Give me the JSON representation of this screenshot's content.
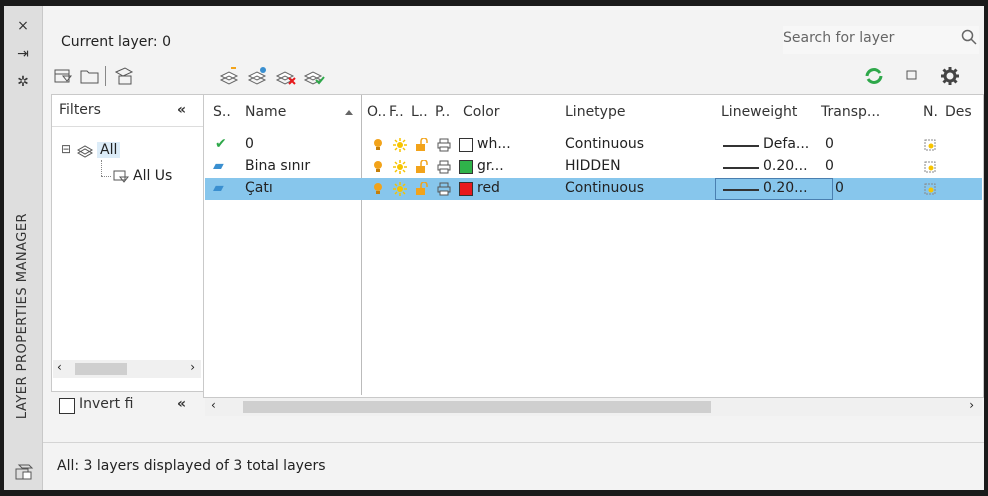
{
  "window": {
    "vertical_title": "LAYER PROPERTIES MANAGER",
    "close_glyph": "×",
    "pin_glyph": "⇥",
    "settings_glyph": "✲"
  },
  "header": {
    "current_layer": "Current layer: 0",
    "search_placeholder": "Search for layer"
  },
  "filters": {
    "title": "Filters",
    "collapse_glyph": "«",
    "tree_all": "All",
    "tree_all_used": "All Us",
    "invert_label": "Invert fi",
    "expand_glyph": "⊟"
  },
  "columns": {
    "status": "S..",
    "name": "Name",
    "on": "O..",
    "freeze": "F..",
    "lock": "L..",
    "plot": "P..",
    "color": "Color",
    "linetype": "Linetype",
    "lineweight": "Lineweight",
    "transparency": "Transp...",
    "newvp": "N.",
    "description": "Des"
  },
  "layers": [
    {
      "status": "✔",
      "name": "0",
      "color_name": "wh...",
      "color_hex": "#ffffff",
      "linetype": "Continuous",
      "lineweight": "Defa...",
      "transparency": "0",
      "selected": false
    },
    {
      "status": "▰",
      "name": "Bina sınır",
      "color_name": "gr...",
      "color_hex": "#2fb34a",
      "linetype": "HIDDEN",
      "lineweight": "0.20...",
      "transparency": "0",
      "selected": false
    },
    {
      "status": "▰",
      "name": "Çatı",
      "color_name": "red",
      "color_hex": "#e8191c",
      "linetype": "Continuous",
      "lineweight": "0.20...",
      "transparency": "0",
      "selected": true
    }
  ],
  "status_bar": {
    "text": "All: 3 layers displayed of 3 total layers"
  },
  "colors": {
    "selection": "#87c6ec",
    "bulb": "#f2a31a",
    "sun": "#f7c400",
    "lock": "#f2a31a",
    "refresh": "#2ea84a"
  }
}
